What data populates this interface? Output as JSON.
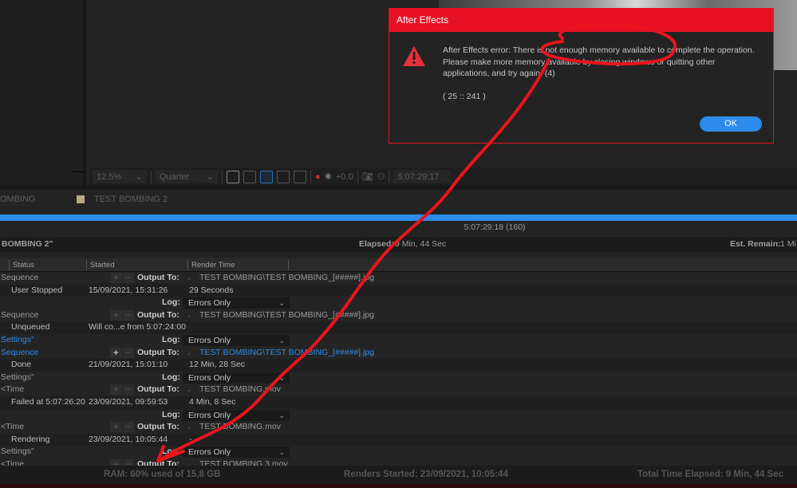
{
  "viewer": {
    "zoom": "12.5%",
    "resolution": "Quarter",
    "exposure": "+0,0",
    "timecode": "5:07:29:17"
  },
  "comp_tabs": [
    {
      "label": "OMBING",
      "swatch": "#b8a988"
    },
    {
      "label": "TEST BOMBING 2"
    }
  ],
  "render": {
    "progress_percent": 100,
    "current_time": "5:07:29:18 (160)",
    "rendering_label": "BOMBING 2\"",
    "elapsed_label": "Elapsed:",
    "elapsed": "9 Min, 44 Sec",
    "est_remain_label": "Est. Remain:",
    "est_remain": "1 Mi"
  },
  "columns": [
    "Status",
    "Started",
    "Render Time"
  ],
  "rows": [
    {
      "type": "output",
      "left": "Sequence",
      "output_label": "Output To:",
      "output": "TEST BOMBING\\TEST BOMBING_[#####].jpg"
    },
    {
      "type": "status",
      "status": "User Stopped",
      "started": "15/09/2021, 15:31:26",
      "render_time": "29 Seconds"
    },
    {
      "type": "log",
      "left": "",
      "log_label": "Log:",
      "log": "Errors Only"
    },
    {
      "type": "output",
      "left": "Sequence",
      "output_label": "Output To:",
      "output": "TEST BOMBING\\TEST BOMBING_[#####].jpg"
    },
    {
      "type": "status",
      "status": "Unqueued",
      "started": "Will co...e from 5:07:24:00",
      "render_time": ""
    },
    {
      "type": "log",
      "left": "Settings\"",
      "left_blue": true,
      "log_label": "Log:",
      "log": "Errors Only"
    },
    {
      "type": "output",
      "left": "Sequence",
      "left_blue": true,
      "output_blue": true,
      "active": true,
      "output_label": "Output To:",
      "output": "TEST BOMBING\\TEST BOMBING_[#####].jpg"
    },
    {
      "type": "status",
      "status": "Done",
      "started": "21/09/2021, 15:01:10",
      "render_time": "12 Min, 28 Sec"
    },
    {
      "type": "log",
      "left": "Settings\"",
      "log_label": "Log:",
      "log": "Errors Only"
    },
    {
      "type": "output",
      "left": "<Time",
      "output_label": "Output To:",
      "output": "TEST BOMBING.mov"
    },
    {
      "type": "status",
      "status": "Failed at 5:07:26:20",
      "started": "23/09/2021, 09:59:53",
      "render_time": "4 Min, 8 Sec"
    },
    {
      "type": "log",
      "left": "",
      "log_label": "Log:",
      "log": "Errors Only"
    },
    {
      "type": "output",
      "left": "<Time",
      "output_label": "Output To:",
      "output": "TEST BOMBING.mov"
    },
    {
      "type": "status",
      "status": "Rendering",
      "started": "23/09/2021, 10:05:44",
      "render_time": "-"
    },
    {
      "type": "log",
      "left": "Settings\"",
      "log_label": "Log:",
      "log": "Errors Only"
    },
    {
      "type": "output",
      "left": "<Time",
      "output_label": "Output To:",
      "output": "TEST BOMBING 3.mov"
    }
  ],
  "footer": {
    "ram": "RAM:  60% used of 15,8 GB",
    "renders_started": "Renders Started:  23/09/2021, 10:05:44",
    "total_elapsed": "Total Time Elapsed: 9 Min, 44 Sec"
  },
  "dialog": {
    "title": "After Effects",
    "message": "After Effects error: There is not enough memory available to complete the operation.  Please make more memory available by closing windows or quitting other applications, and try again.  (4)",
    "code": "( 25 :: 241 )",
    "ok_label": "OK",
    "accent": "#e81123"
  },
  "colors": {
    "accent_blue": "#2d8ceb",
    "annotation_red": "#e8141c"
  }
}
